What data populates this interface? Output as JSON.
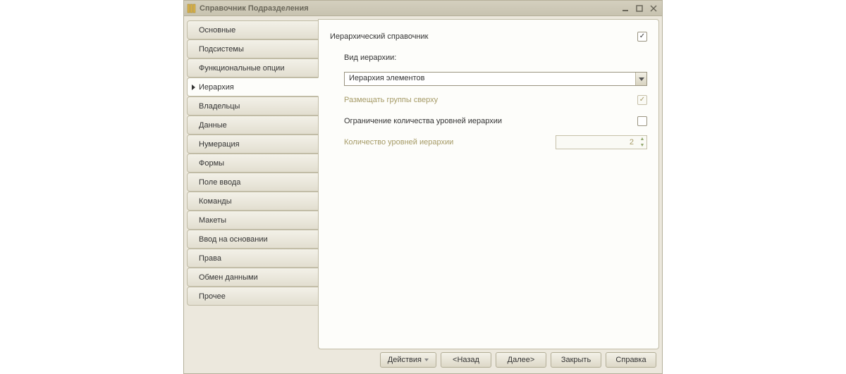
{
  "window": {
    "title": "Справочник Подразделения"
  },
  "sidebar": {
    "items": [
      {
        "label": "Основные"
      },
      {
        "label": "Подсистемы"
      },
      {
        "label": "Функциональные опции"
      },
      {
        "label": "Иерархия",
        "active": true
      },
      {
        "label": "Владельцы"
      },
      {
        "label": "Данные"
      },
      {
        "label": "Нумерация"
      },
      {
        "label": "Формы"
      },
      {
        "label": "Поле ввода"
      },
      {
        "label": "Команды"
      },
      {
        "label": "Макеты"
      },
      {
        "label": "Ввод на основании"
      },
      {
        "label": "Права"
      },
      {
        "label": "Обмен данными"
      },
      {
        "label": "Прочее"
      }
    ]
  },
  "form": {
    "hierarchical_label": "Иерархический справочник",
    "hierarchical_checked": true,
    "hierarchy_type_label": "Вид иерархии:",
    "hierarchy_type_value": "Иерархия элементов",
    "groups_on_top_label": "Размещать группы сверху",
    "groups_on_top_checked": true,
    "limit_levels_label": "Ограничение количества уровней иерархии",
    "limit_levels_checked": false,
    "levels_count_label": "Количество уровней иерархии",
    "levels_count_value": "2"
  },
  "footer": {
    "actions": "Действия",
    "back": "<Назад",
    "next": "Далее>",
    "close": "Закрыть",
    "help": "Справка"
  }
}
